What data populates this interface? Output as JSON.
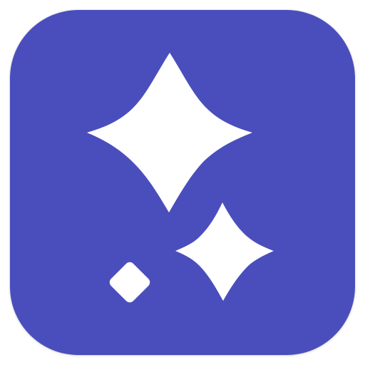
{
  "icon": {
    "name": "sparkles-icon",
    "background_color": "#4A4EBC",
    "foreground_color": "#FFFFFF"
  }
}
